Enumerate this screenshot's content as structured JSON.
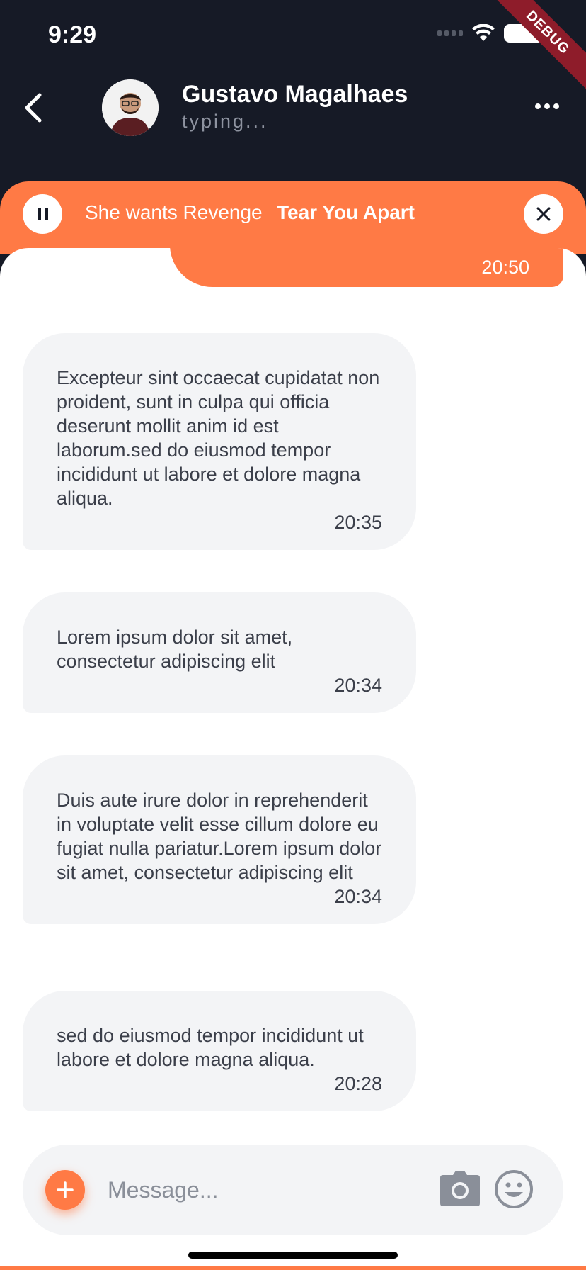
{
  "status_bar": {
    "time": "9:29"
  },
  "debug_banner": "DEBUG",
  "header": {
    "contact_name": "Gustavo Magalhaes",
    "contact_status": "typing..."
  },
  "now_playing": {
    "artist": "She wants Revenge",
    "title": "Tear You Apart"
  },
  "sent_message": {
    "time": "20:50"
  },
  "messages": [
    {
      "text": "Excepteur sint occaecat cupidatat non proident, sunt in culpa qui officia deserunt mollit anim id est laborum.sed do eiusmod tempor incididunt ut labore et dolore magna aliqua.",
      "time": "20:35"
    },
    {
      "text": "Lorem ipsum dolor sit amet, consectetur adipiscing elit",
      "time": "20:34"
    },
    {
      "text": "Duis aute irure dolor in reprehenderit in voluptate velit esse cillum dolore eu fugiat nulla pariatur.Lorem ipsum dolor sit amet, consectetur adipiscing elit",
      "time": "20:34"
    },
    {
      "text": "sed do eiusmod tempor incididunt ut labore et dolore magna aliqua.",
      "time": "20:28"
    }
  ],
  "composer": {
    "placeholder": "Message..."
  },
  "colors": {
    "accent": "#ff7a45",
    "header_bg": "#161a26",
    "bubble_bg": "#f3f4f6"
  }
}
